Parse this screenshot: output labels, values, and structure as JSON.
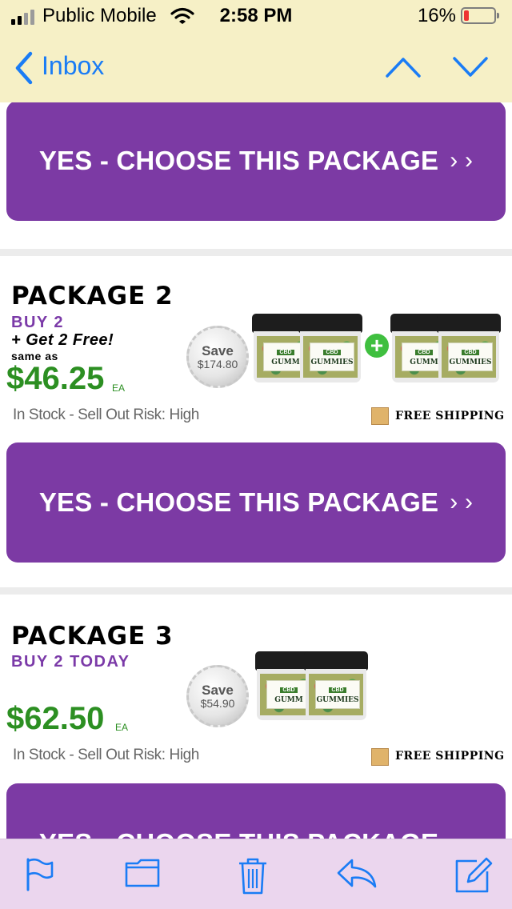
{
  "status_bar": {
    "carrier": "Public Mobile",
    "time": "2:58 PM",
    "battery_percent": "16%",
    "battery_level": 0.16,
    "signal_bars_filled": 2,
    "signal_bars_total": 4
  },
  "nav": {
    "back_label": "Inbox",
    "icons": [
      "chevron-left-icon",
      "chevron-up-icon",
      "chevron-down-icon"
    ]
  },
  "email": {
    "cta_label": "YES - CHOOSE THIS PACKAGE",
    "cta_chevrons": "› ›",
    "packages": [
      {
        "title": "PACKAGE 2",
        "buy_line": "BUY 2",
        "free_line": "+ Get 2 Free!",
        "same_as": "same as",
        "price": "$46.25",
        "unit": "EA",
        "save_label": "Save",
        "save_amount": "$174.80",
        "jar_badge": "CBD",
        "jar_name": "GUMMIES",
        "jar_name_cropped": "GUMM",
        "stock": "In Stock - Sell Out Risk: High",
        "shipping": "FREE SHIPPING"
      },
      {
        "title": "PACKAGE 3",
        "buy_line": "BUY 2 TODAY",
        "price": "$62.50",
        "unit": "EA",
        "save_label": "Save",
        "save_amount": "$54.90",
        "jar_badge": "CBD",
        "jar_name": "GUMMIES",
        "jar_name_cropped": "GUMM",
        "stock": "In Stock - Sell Out Risk: High",
        "shipping": "FREE SHIPPING"
      }
    ]
  },
  "toolbar": {
    "icons": [
      "flag-icon",
      "folder-icon",
      "trash-icon",
      "reply-icon",
      "compose-icon"
    ]
  },
  "colors": {
    "accent_blue": "#1a7cf5",
    "cta_purple": "#7c3aa4",
    "price_green": "#2c8f22",
    "buy_purple": "#7b3aa8",
    "toolbar_bg": "#ebd6ee",
    "status_bg": "#f6f0c6"
  }
}
